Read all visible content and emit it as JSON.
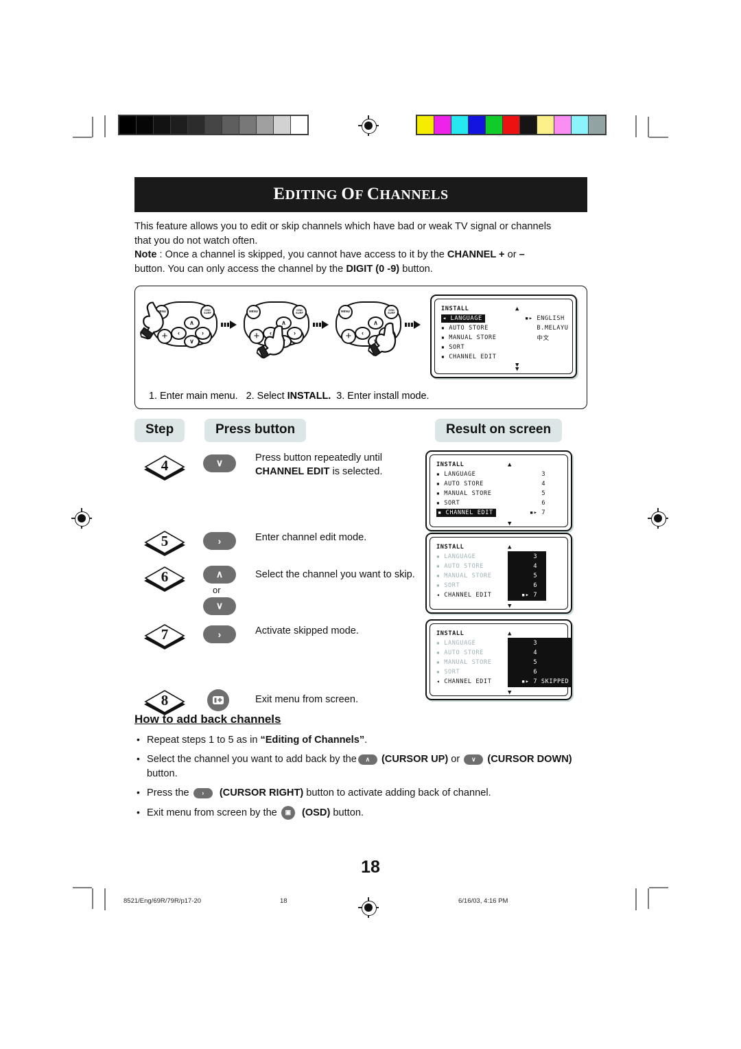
{
  "document": {
    "title": "EDITING OF CHANNELS",
    "page_number": "18"
  },
  "intro": {
    "line1": "This feature allows you to edit or skip channels which have bad or weak TV signal or channels",
    "line2": "that you do not watch often.",
    "note_label": "Note",
    "note_1": " : Once a channel is skipped, you cannot have access to it by the ",
    "note_channel": "CHANNEL +",
    "note_2": " or ",
    "note_minus": "–",
    "note_3": "button. You can only access the channel by the ",
    "note_digit": "DIGIT (0 -9)",
    "note_4": " button."
  },
  "flow": {
    "caption_1": "1. Enter main menu.",
    "caption_2_pre": "2.  Select ",
    "caption_2_bold": "INSTALL.",
    "caption_3": "3.  Enter install mode.",
    "remote": {
      "menu_label": "MENU",
      "osd_label": "OSD SURF",
      "plus_label": "+",
      "up": "∧",
      "down": "∨",
      "left": "‹",
      "right": "›"
    },
    "osd": {
      "header": "INSTALL",
      "items": [
        "LANGUAGE",
        "AUTO STORE",
        "MANUAL STORE",
        "SORT",
        "CHANNEL EDIT"
      ],
      "selected_index": 0,
      "values": [
        "ENGLISH",
        "B.MELAYU",
        "中文"
      ],
      "cursor_glyph": "▪▸",
      "left_glyph": "◂",
      "up_glyph": "▲",
      "down_glyph": "▼"
    }
  },
  "headers": {
    "step": "Step",
    "press_button": "Press button",
    "result": "Result on screen"
  },
  "steps": [
    {
      "number": "4",
      "keys": [
        {
          "glyph": "∨",
          "name": "cursor-down"
        }
      ],
      "text_line1": "Press button repeatedly until",
      "text_bold": "CHANNEL EDIT",
      "text_line2_tail": " is selected."
    },
    {
      "number": "5",
      "keys": [
        {
          "glyph": "›",
          "name": "cursor-right"
        }
      ],
      "text_line1": "Enter channel edit mode."
    },
    {
      "number": "6",
      "keys": [
        {
          "glyph": "∧",
          "name": "cursor-up"
        },
        {
          "glyph": "∨",
          "name": "cursor-down"
        }
      ],
      "or_label": "or",
      "text_line1": "Select the channel you want to skip."
    },
    {
      "number": "7",
      "keys": [
        {
          "glyph": "›",
          "name": "cursor-right"
        }
      ],
      "text_line1": "Activate skipped mode."
    },
    {
      "number": "8",
      "keys": [
        {
          "glyph": "▣",
          "name": "osd"
        }
      ],
      "text_line1": "Exit menu from screen."
    }
  ],
  "results": [
    {
      "header": "INSTALL",
      "items": [
        "LANGUAGE",
        "AUTO STORE",
        "MANUAL STORE",
        "SORT",
        "CHANNEL EDIT"
      ],
      "numbers": [
        "3",
        "4",
        "5",
        "6",
        "7"
      ],
      "highlight_index": 4,
      "highlight_mode": "label",
      "cursor_glyph": "▪▸",
      "dimmed": false,
      "skipped_text": ""
    },
    {
      "header": "INSTALL",
      "items": [
        "LANGUAGE",
        "AUTO STORE",
        "MANUAL STORE",
        "SORT",
        "CHANNEL EDIT"
      ],
      "numbers": [
        "3",
        "4",
        "5",
        "6",
        "7"
      ],
      "highlight_index": 4,
      "highlight_mode": "numbers",
      "cursor_glyph": "▪▸",
      "dimmed": true,
      "skipped_text": ""
    },
    {
      "header": "INSTALL",
      "items": [
        "LANGUAGE",
        "AUTO STORE",
        "MANUAL STORE",
        "SORT",
        "CHANNEL EDIT"
      ],
      "numbers": [
        "3",
        "4",
        "5",
        "6",
        "7"
      ],
      "highlight_index": 4,
      "highlight_mode": "numbers",
      "cursor_glyph": "▪▸",
      "dimmed": true,
      "skipped_text": "SKIPPED"
    }
  ],
  "howto": {
    "heading": "How to add back channels",
    "b1_pre": "Repeat steps 1 to 5 as in ",
    "b1_bold": "“Editing of Channels”",
    "b1_post": ".",
    "b2_pre": "Select the channel you want to add back by the",
    "b2_up_key": "∧",
    "b2_up_label": "(CURSOR UP)",
    "b2_or": " or ",
    "b2_dn_key": "∨",
    "b2_dn_label": "(CURSOR",
    "b2_dn_label2": "DOWN)",
    "b2_post": " button.",
    "b3_pre": "Press the ",
    "b3_key": "›",
    "b3_label": "(CURSOR RIGHT)",
    "b3_post": " button to activate adding back of channel.",
    "b4_pre": "Exit menu from screen by the ",
    "b4_key": "▣",
    "b4_label": "(OSD)",
    "b4_post": " button."
  },
  "footer": {
    "file": "8521/Eng/69R/79R/p17-20",
    "page": "18",
    "date": "6/16/03, 4:16 PM"
  },
  "calibration": {
    "gray_swatches": [
      "#000000",
      "#060606",
      "#121212",
      "#1e1e1e",
      "#2c2c2c",
      "#454545",
      "#5e5e5e",
      "#787878",
      "#a0a0a0",
      "#d2d2d2",
      "#ffffff"
    ],
    "color_swatches": [
      "#f5ec00",
      "#ee22e8",
      "#26e8ee",
      "#1414e0",
      "#10cc2a",
      "#ee1111",
      "#151515",
      "#fbf08a",
      "#fb8ef2",
      "#8af3fb",
      "#92a3a3"
    ]
  }
}
